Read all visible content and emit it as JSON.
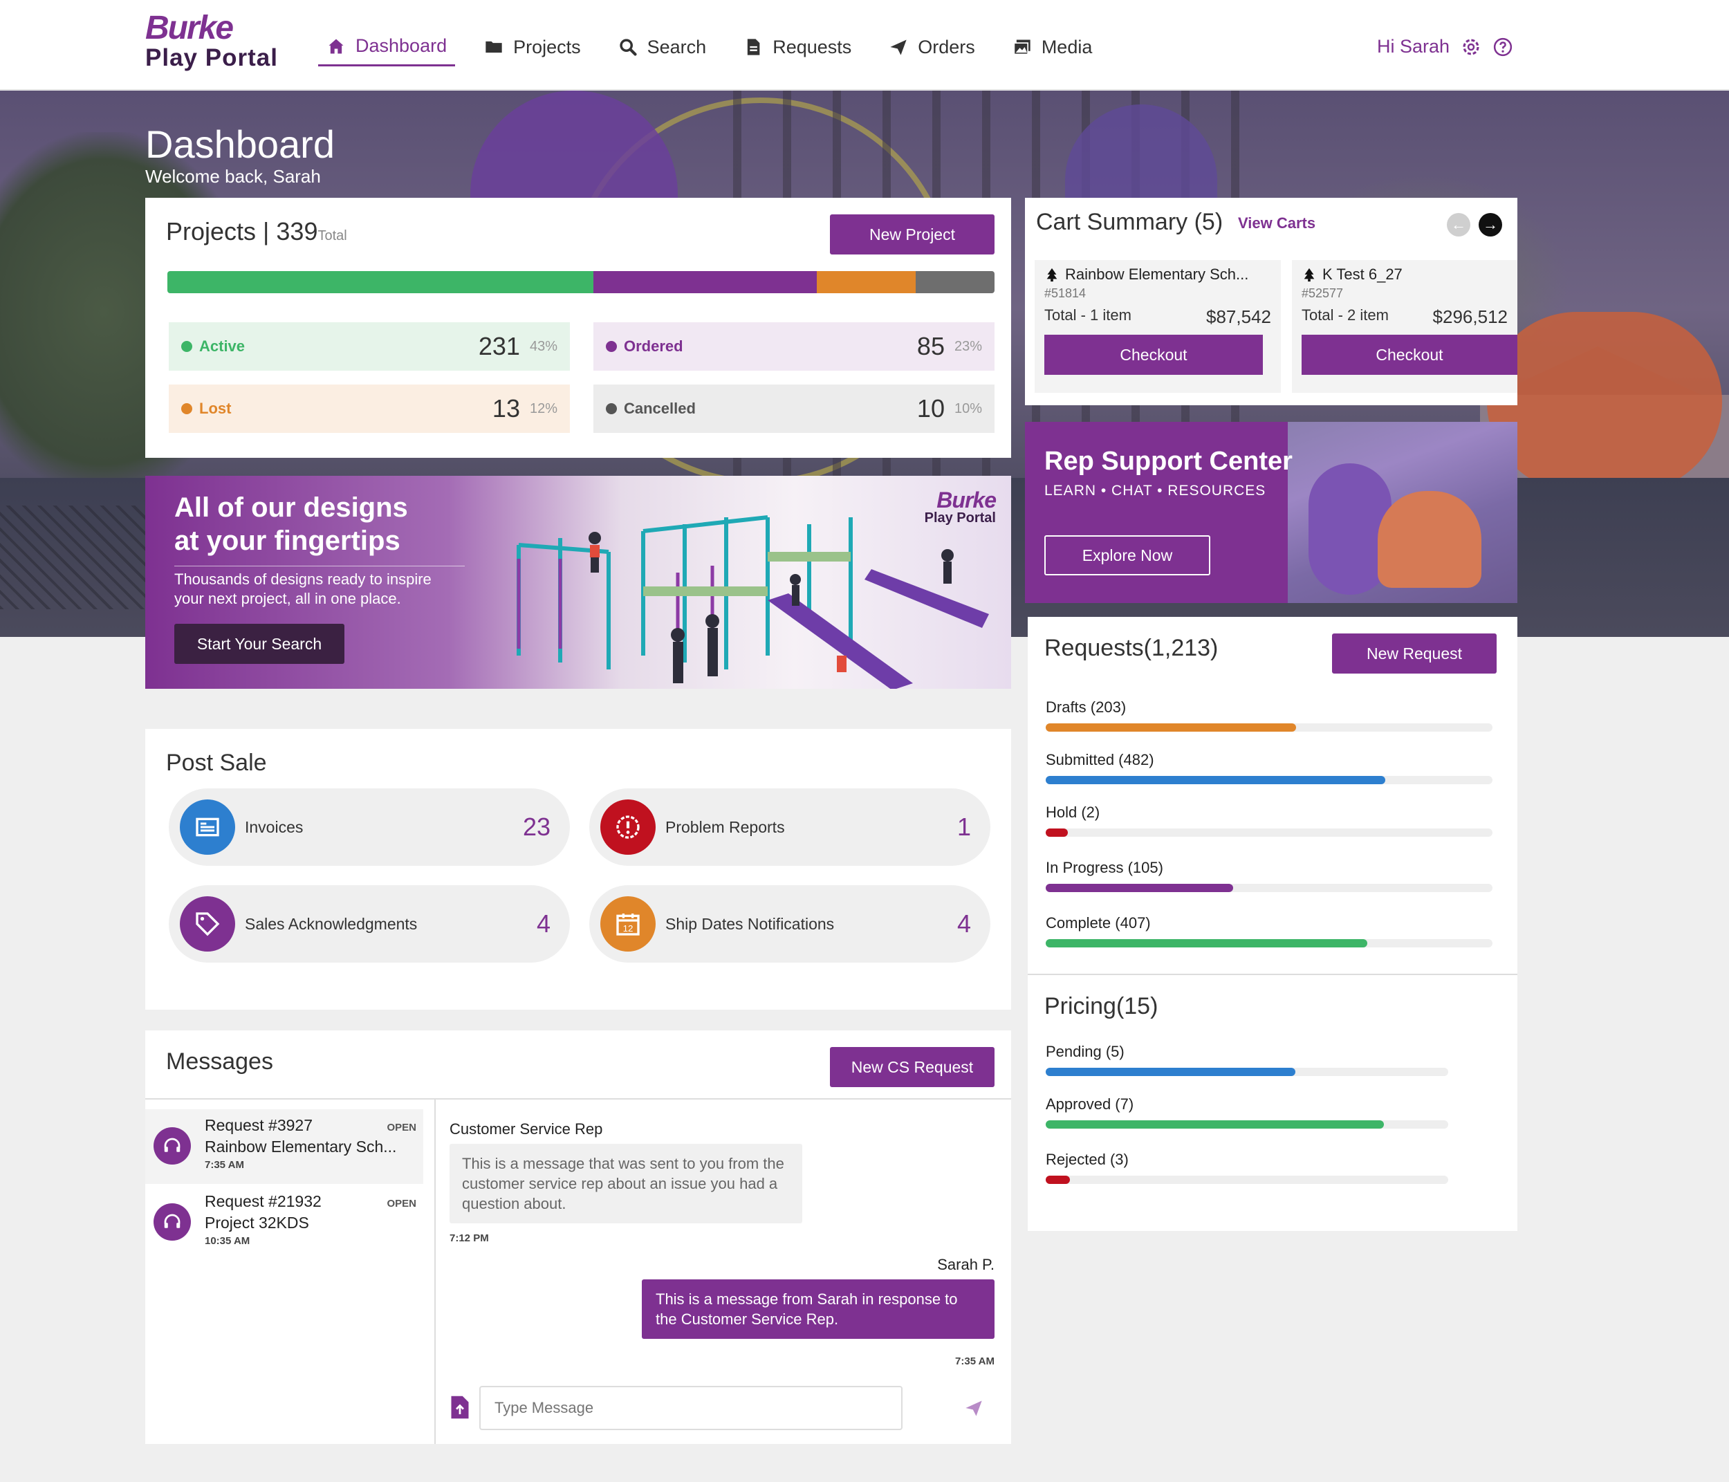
{
  "header": {
    "logo_line1": "Burke",
    "logo_line2": "Play Portal",
    "nav": [
      {
        "label": "Dashboard",
        "icon": "home-icon",
        "active": true
      },
      {
        "label": "Projects",
        "icon": "folder-icon"
      },
      {
        "label": "Search",
        "icon": "search-icon"
      },
      {
        "label": "Requests",
        "icon": "document-icon"
      },
      {
        "label": "Orders",
        "icon": "send-icon"
      },
      {
        "label": "Media",
        "icon": "images-icon"
      }
    ],
    "greeting": "Hi Sarah"
  },
  "hero": {
    "title": "Dashboard",
    "subtitle": "Welcome back, Sarah"
  },
  "projects": {
    "title": "Projects",
    "count": "339",
    "count_label": "Total",
    "new_button": "New Project",
    "bar": [
      {
        "name": "Active",
        "percent": 51.5,
        "color": "#3db567"
      },
      {
        "name": "Ordered",
        "percent": 27,
        "color": "#7e3191"
      },
      {
        "name": "Lost",
        "percent": 12,
        "color": "#e0862a"
      },
      {
        "name": "Cancelled",
        "percent": 9.5,
        "color": "#6e6e6e"
      }
    ],
    "stats": [
      {
        "label": "Active",
        "value": "231",
        "pct": "43%",
        "color": "#3db567",
        "bg": "#e6f4ea"
      },
      {
        "label": "Ordered",
        "value": "85",
        "pct": "23%",
        "color": "#7e3191",
        "bg": "#f1e8f3"
      },
      {
        "label": "Lost",
        "value": "13",
        "pct": "12%",
        "color": "#e0862a",
        "bg": "#fbeee2"
      },
      {
        "label": "Cancelled",
        "value": "10",
        "pct": "10%",
        "color": "#555555",
        "bg": "#ececec"
      }
    ]
  },
  "designs_banner": {
    "heading_line1": "All of our designs",
    "heading_line2": "at your fingertips",
    "text": "Thousands of designs ready to inspire your next project, all in one place.",
    "button": "Start Your Search",
    "logo_line1": "Burke",
    "logo_line2": "Play Portal"
  },
  "cart": {
    "title": "Cart Summary (5)",
    "view_link": "View Carts",
    "items": [
      {
        "name": "Rainbow Elementary Sch...",
        "id": "#51814",
        "total_label": "Total - 1 item",
        "amount": "$87,542",
        "button": "Checkout"
      },
      {
        "name": "K Test 6_27",
        "id": "#52577",
        "total_label": "Total - 2 item",
        "amount": "$296,512",
        "button": "Checkout"
      }
    ]
  },
  "rep_support": {
    "title": "Rep Support Center",
    "subtitle": "LEARN • CHAT • RESOURCES",
    "button": "Explore Now"
  },
  "post_sale": {
    "title": "Post Sale",
    "items": [
      {
        "label": "Invoices",
        "value": "23",
        "icon": "invoice-icon",
        "color": "#2d7fcf"
      },
      {
        "label": "Problem Reports",
        "value": "1",
        "icon": "alert-icon",
        "color": "#c0111f"
      },
      {
        "label": "Sales Acknowledgments",
        "value": "4",
        "icon": "tag-icon",
        "color": "#7e3191"
      },
      {
        "label": "Ship Dates Notifications",
        "value": "4",
        "icon": "calendar-icon",
        "color": "#e0862a"
      }
    ]
  },
  "messages": {
    "title": "Messages",
    "new_button": "New CS Request",
    "threads": [
      {
        "title": "Request #3927",
        "status": "OPEN",
        "subtitle": "Rainbow Elementary Sch...",
        "time": "7:35 AM"
      },
      {
        "title": "Request #21932",
        "status": "OPEN",
        "subtitle": "Project 32KDS",
        "time": "10:35 AM"
      }
    ],
    "chat": {
      "sender": "Customer Service Rep",
      "incoming": "This is a message that was sent to you from the customer service rep about an issue you had a question about.",
      "incoming_time": "7:12 PM",
      "me": "Sarah P.",
      "outgoing": "This is a message from Sarah in response to the Customer Service Rep.",
      "outgoing_time": "7:35 AM",
      "input_placeholder": "Type Message"
    }
  },
  "requests": {
    "title": "Requests",
    "count": "(1,213)",
    "new_button": "New Request",
    "bars": [
      {
        "label": "Drafts (203)",
        "fraction": 0.56,
        "color": "#e0862a"
      },
      {
        "label": "Submitted (482)",
        "fraction": 0.76,
        "color": "#2d7fcf"
      },
      {
        "label": "Hold (2)",
        "fraction": 0.05,
        "color": "#c0111f"
      },
      {
        "label": "In Progress (105)",
        "fraction": 0.42,
        "color": "#7e3191"
      },
      {
        "label": "Complete (407)",
        "fraction": 0.72,
        "color": "#3db567"
      }
    ]
  },
  "pricing": {
    "title": "Pricing",
    "count": "(15)",
    "bars": [
      {
        "label": "Pending (5)",
        "fraction": 0.62,
        "color": "#2d7fcf"
      },
      {
        "label": "Approved (7)",
        "fraction": 0.84,
        "color": "#3db567"
      },
      {
        "label": "Rejected (3)",
        "fraction": 0.06,
        "color": "#c0111f"
      }
    ]
  }
}
